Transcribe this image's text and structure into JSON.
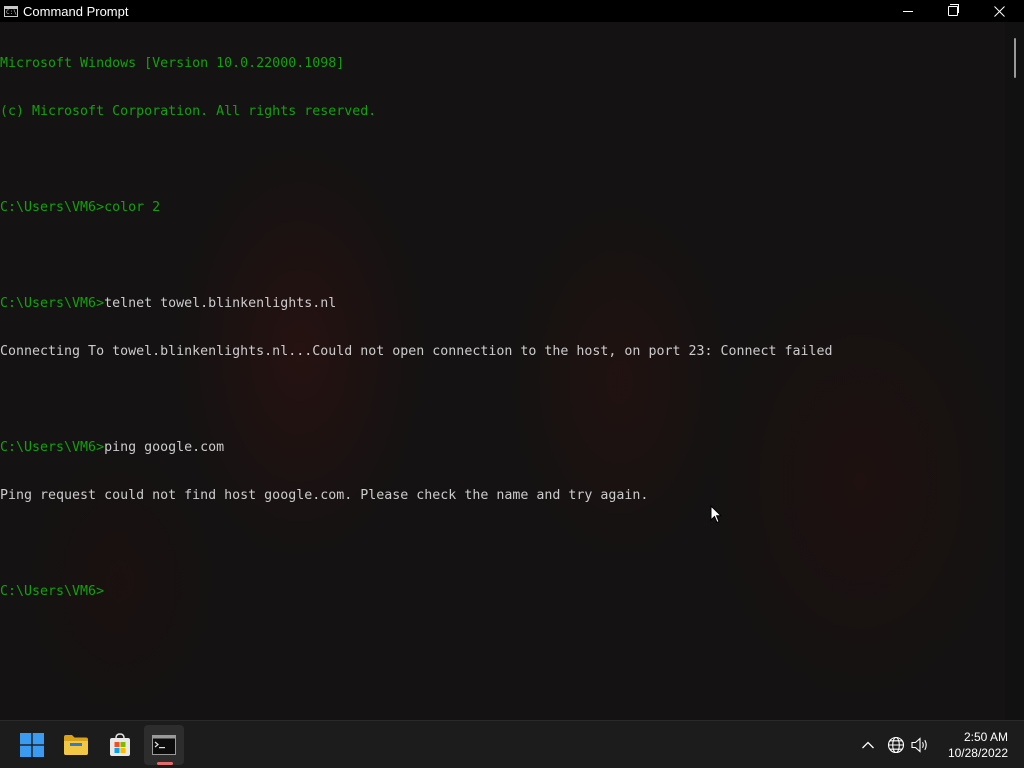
{
  "window": {
    "title": "Command Prompt",
    "icon": "cmd-icon",
    "icon_glyph": "C:\\"
  },
  "console": {
    "text_color": "#13a10e",
    "lines": [
      {
        "prompt": "Microsoft Windows [Version 10.0.22000.1098]",
        "cmd": ""
      },
      {
        "prompt": "(c) Microsoft Corporation. All rights reserved.",
        "cmd": ""
      },
      {
        "prompt": "",
        "cmd": ""
      },
      {
        "prompt": "C:\\Users\\VM6>color 2",
        "cmd": ""
      },
      {
        "prompt": "",
        "cmd": ""
      },
      {
        "prompt": "C:\\Users\\VM6>",
        "cmd": "telnet towel.blinkenlights.nl"
      },
      {
        "prompt": "",
        "cmd": "Connecting To towel.blinkenlights.nl...Could not open connection to the host, on port 23: Connect failed"
      },
      {
        "prompt": "",
        "cmd": ""
      },
      {
        "prompt": "C:\\Users\\VM6>",
        "cmd": "ping google.com"
      },
      {
        "prompt": "",
        "cmd": "Ping request could not find host google.com. Please check the name and try again."
      },
      {
        "prompt": "",
        "cmd": ""
      },
      {
        "prompt": "C:\\Users\\VM6>",
        "cmd": ""
      }
    ]
  },
  "taskbar": {
    "items": [
      {
        "name": "start-button",
        "icon": "windows-logo-icon"
      },
      {
        "name": "file-explorer",
        "icon": "folder-icon"
      },
      {
        "name": "microsoft-store",
        "icon": "store-icon"
      },
      {
        "name": "command-prompt",
        "icon": "terminal-icon",
        "active": true
      }
    ],
    "tray": {
      "icons": [
        "chevron-up-icon",
        "globe-icon",
        "speaker-icon"
      ]
    },
    "clock": {
      "time": "2:50 AM",
      "date": "10/28/2022"
    }
  },
  "colors": {
    "console_green": "#13a10e",
    "console_white": "#cccccc",
    "active_indicator": "#e36b6b",
    "windows_blue": "#3a9bf0",
    "folder_yellow": "#f2c744"
  }
}
